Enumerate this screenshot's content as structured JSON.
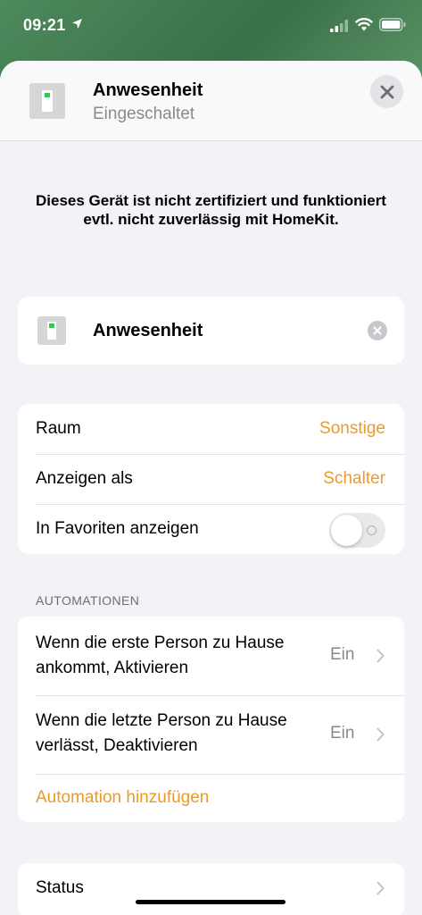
{
  "status_bar": {
    "time": "09:21"
  },
  "header": {
    "title": "Anwesenheit",
    "subtitle": "Eingeschaltet"
  },
  "warning": "Dieses Gerät ist nicht zertifiziert und funktioniert evtl. nicht zuverlässig mit HomeKit.",
  "accessory": {
    "name": "Anwesenheit"
  },
  "settings": {
    "room_label": "Raum",
    "room_value": "Sonstige",
    "display_label": "Anzeigen als",
    "display_value": "Schalter",
    "favorites_label": "In Favoriten anzeigen",
    "favorites_enabled": false
  },
  "automations": {
    "section_title": "AUTOMATIONEN",
    "items": [
      {
        "label_line1": "Wenn die erste Person zu Hause",
        "label_line2": "ankommt, Aktivieren",
        "state": "Ein"
      },
      {
        "label_line1": "Wenn die letzte Person zu Hause",
        "label_line2": "verlässt, Deaktivieren",
        "state": "Ein"
      }
    ],
    "add_label": "Automation hinzufügen"
  },
  "status": {
    "label": "Status"
  },
  "colors": {
    "accent": "#eb9a2c",
    "background": "#f2f2f7",
    "secondary_text": "#8a8a8e"
  }
}
